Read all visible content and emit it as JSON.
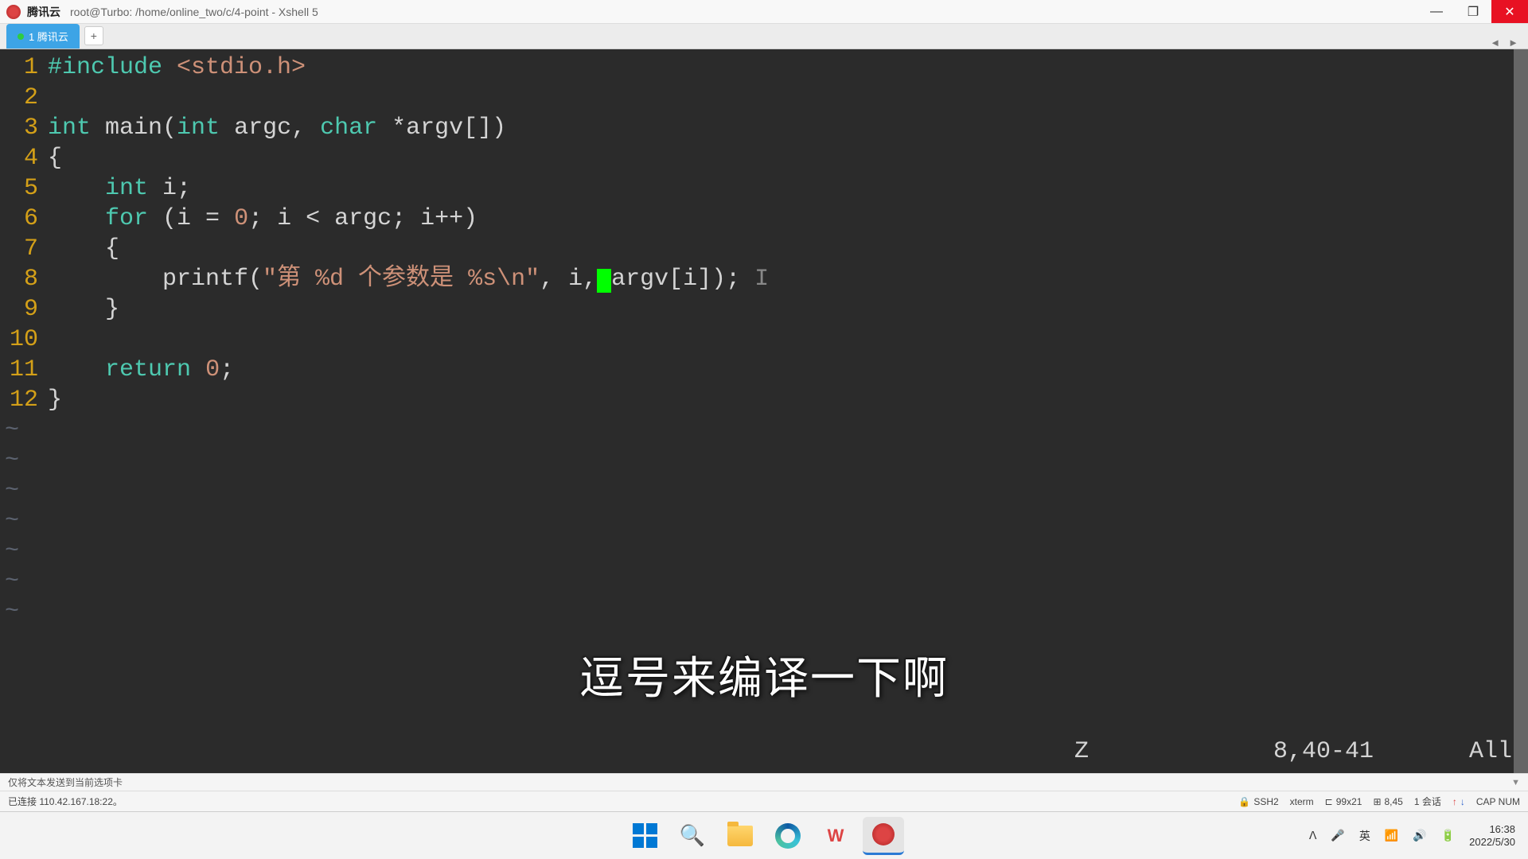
{
  "titlebar": {
    "host": "腾讯云",
    "path": "root@Turbo: /home/online_two/c/4-point - Xshell 5"
  },
  "tabs": {
    "active": "1 腾讯云",
    "add": "+"
  },
  "tabnav": {
    "prev": "◄",
    "next": "►"
  },
  "code": {
    "lines": [
      {
        "n": "1",
        "tokens": [
          [
            "#include ",
            "kw"
          ],
          [
            "<stdio.h>",
            "str"
          ]
        ]
      },
      {
        "n": "2",
        "tokens": []
      },
      {
        "n": "3",
        "tokens": [
          [
            "int",
            "type"
          ],
          [
            " main(",
            "fn"
          ],
          [
            "int",
            "type"
          ],
          [
            " argc, ",
            "fn"
          ],
          [
            "char",
            "type"
          ],
          [
            " *argv[])",
            "fn"
          ]
        ]
      },
      {
        "n": "4",
        "tokens": [
          [
            "{",
            "fn"
          ]
        ]
      },
      {
        "n": "5",
        "tokens": [
          [
            "    ",
            "fn"
          ],
          [
            "int",
            "type"
          ],
          [
            " i;",
            "fn"
          ]
        ]
      },
      {
        "n": "6",
        "tokens": [
          [
            "    ",
            "fn"
          ],
          [
            "for",
            "kw"
          ],
          [
            " (i = ",
            "fn"
          ],
          [
            "0",
            "num"
          ],
          [
            "; i < argc; i++)",
            "fn"
          ]
        ]
      },
      {
        "n": "7",
        "tokens": [
          [
            "    {",
            "fn"
          ]
        ]
      },
      {
        "n": "8",
        "tokens": [
          [
            "        printf(",
            "fn"
          ],
          [
            "\"第 %d 个参数是 %s\\n\"",
            "str"
          ],
          [
            ", i,",
            "fn"
          ]
        ],
        "cursor": true,
        "tail": [
          [
            "argv[i]);",
            "fn"
          ]
        ],
        "ibeam": " I"
      },
      {
        "n": "9",
        "tokens": [
          [
            "    }",
            "fn"
          ]
        ]
      },
      {
        "n": "10",
        "tokens": []
      },
      {
        "n": "11",
        "tokens": [
          [
            "    ",
            "fn"
          ],
          [
            "return",
            "kw"
          ],
          [
            " ",
            "fn"
          ],
          [
            "0",
            "num"
          ],
          [
            ";",
            "fn"
          ]
        ]
      },
      {
        "n": "12",
        "tokens": [
          [
            "}",
            "fn"
          ]
        ]
      }
    ],
    "tilde_count": 7
  },
  "vim": {
    "mode": "Z",
    "position": "8,40-41",
    "view": "All"
  },
  "subtitle": "逗号来编译一下啊",
  "status1": {
    "left": "仅将文本发送到当前选项卡",
    "right": "▼"
  },
  "status2": {
    "left": "已连接 110.42.167.18:22。",
    "ssh": "SSH2",
    "term": "xterm",
    "size": "99x21",
    "cursor": "8,45",
    "sessions": "1 会话",
    "caps": "CAP NUM"
  },
  "tray": {
    "ime": "英",
    "time": "16:38",
    "date": "2022/5/30"
  },
  "icons": {
    "chevron_up": "ᐱ",
    "mic": "🎤",
    "wifi": "📶",
    "volume": "🔊",
    "battery": "🔋",
    "search": "🔍",
    "lock": "🔒",
    "up_arrow": "↑",
    "down_arrow": "↓",
    "minimize": "—",
    "maximize": "❐",
    "close": "✕"
  }
}
